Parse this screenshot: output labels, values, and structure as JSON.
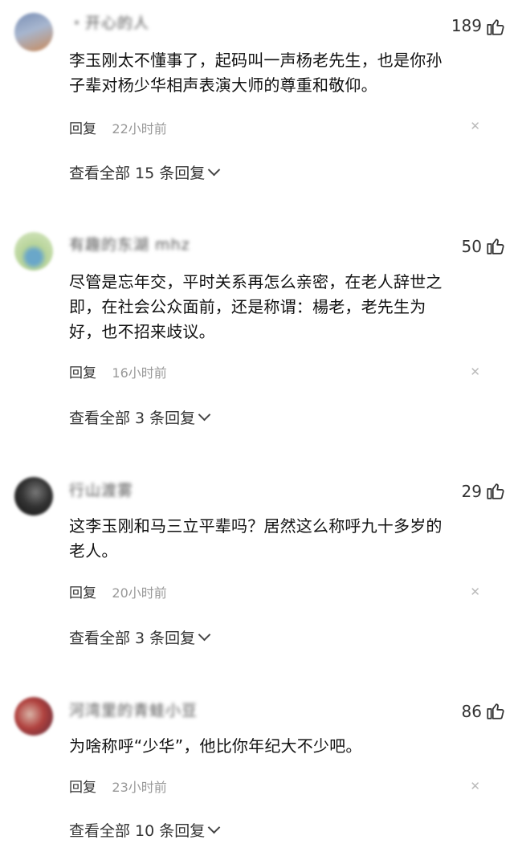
{
  "comments": [
    {
      "username": "・开心的人",
      "likes": "189",
      "lines": [
        "李玉刚太不懂事了，起码叫一声杨老先生，也是你孙",
        "子辈对杨少华相声表演大师的尊重和敬仰。"
      ],
      "reply_label": "回复",
      "time": "22小时前",
      "view_all": "查看全部 15 条回复",
      "avatar_colors": [
        "#7a8fb5",
        "#c98a5a"
      ]
    },
    {
      "username": "有趣的东湖 mhz",
      "likes": "50",
      "lines": [
        "尽管是忘年交，平时关系再怎么亲密，在老人辞世之",
        "即，在社会公众面前，还是称谓：楊老，老先生为",
        "好，也不招来歧议。"
      ],
      "reply_label": "回复",
      "time": "16小时前",
      "view_all": "查看全部 3 条回复",
      "avatar_colors": [
        "#b8d49a",
        "#6aa7c9"
      ]
    },
    {
      "username": "行山渡雾",
      "likes": "29",
      "lines": [
        "这李玉刚和马三立平辈吗？居然这么称呼九十多岁的",
        "老人。"
      ],
      "reply_label": "回复",
      "time": "20小时前",
      "view_all": "查看全部 3 条回复",
      "avatar_colors": [
        "#222222",
        "#777777"
      ]
    },
    {
      "username": "河湾里的青蛙小豆",
      "likes": "86",
      "lines": [
        "为啥称呼“少华”，他比你年纪大不少吧。"
      ],
      "reply_label": "回复",
      "time": "23小时前",
      "view_all": "查看全部 10 条回复",
      "avatar_colors": [
        "#b0413e",
        "#d9b3a6"
      ]
    }
  ]
}
